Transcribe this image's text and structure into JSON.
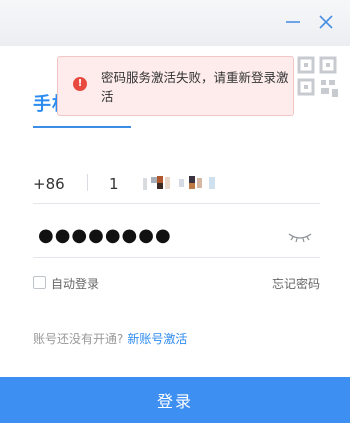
{
  "window": {
    "minimize_icon": "minimize-icon",
    "close_icon": "close-icon"
  },
  "qr": {
    "icon": "qr-code-icon"
  },
  "tab": {
    "label": "手机号登录"
  },
  "toast": {
    "message": "密码服务激活失败，请重新登录激活",
    "icon": "error-icon",
    "color": "#e84a3f"
  },
  "phone": {
    "prefix": "+86",
    "value": "1"
  },
  "password": {
    "masked": "●●●●●●●●",
    "toggle_icon": "eye-closed-icon"
  },
  "options": {
    "auto_login": "自动登录",
    "forgot_password": "忘记密码"
  },
  "activate": {
    "question": "账号还没有开通?",
    "link": "新账号激活"
  },
  "login_button": {
    "label": "登录",
    "color": "#3d8ff2"
  },
  "accent_color": "#2d8cf0"
}
